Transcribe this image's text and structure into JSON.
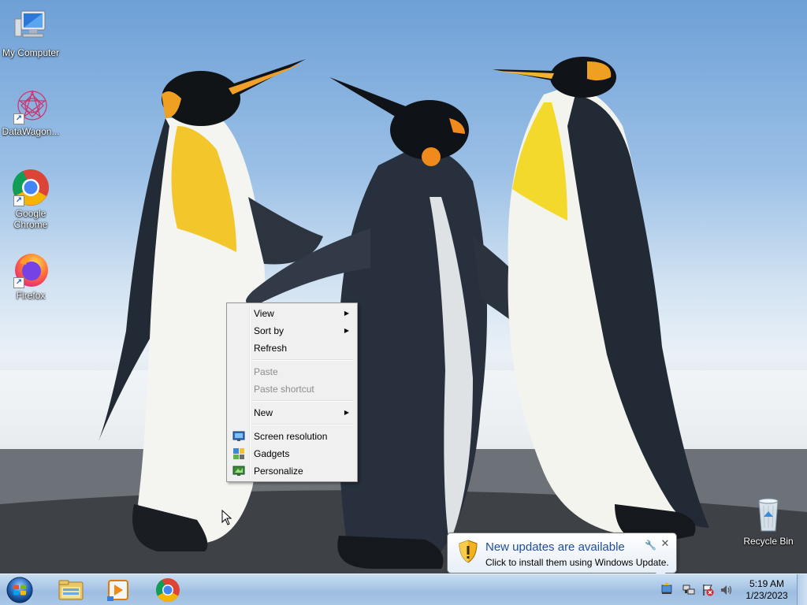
{
  "desktop": {
    "icons": [
      {
        "label": "My Computer"
      },
      {
        "label": "DataWagon..."
      },
      {
        "label": "Google Chrome"
      },
      {
        "label": "Firefox"
      },
      {
        "label": "Recycle Bin"
      }
    ]
  },
  "context_menu": {
    "items": [
      {
        "label": "View",
        "has_submenu": true,
        "enabled": true
      },
      {
        "label": "Sort by",
        "has_submenu": true,
        "enabled": true
      },
      {
        "label": "Refresh",
        "enabled": true
      },
      {
        "label": "Paste",
        "enabled": false
      },
      {
        "label": "Paste shortcut",
        "enabled": false
      },
      {
        "label": "New",
        "has_submenu": true,
        "enabled": true
      },
      {
        "label": "Screen resolution",
        "icon": "screen-resolution-icon",
        "enabled": true
      },
      {
        "label": "Gadgets",
        "icon": "gadgets-icon",
        "enabled": true
      },
      {
        "label": "Personalize",
        "icon": "personalize-icon",
        "enabled": true
      }
    ]
  },
  "notification": {
    "title": "New updates are available",
    "body": "Click to install them using Windows Update.",
    "close_glyph": "✕",
    "options_glyph": "🔧"
  },
  "taskbar": {
    "pinned": [
      {
        "name": "windows-explorer"
      },
      {
        "name": "windows-media-player"
      },
      {
        "name": "google-chrome"
      }
    ],
    "clock": {
      "time": "5:19 AM",
      "date": "1/23/2023"
    }
  },
  "colors": {
    "taskbar": "#a8c6e6",
    "menu_bg": "#f0f0f0",
    "balloon_title": "#1f4ea1",
    "disabled_text": "#8d8d8d"
  }
}
